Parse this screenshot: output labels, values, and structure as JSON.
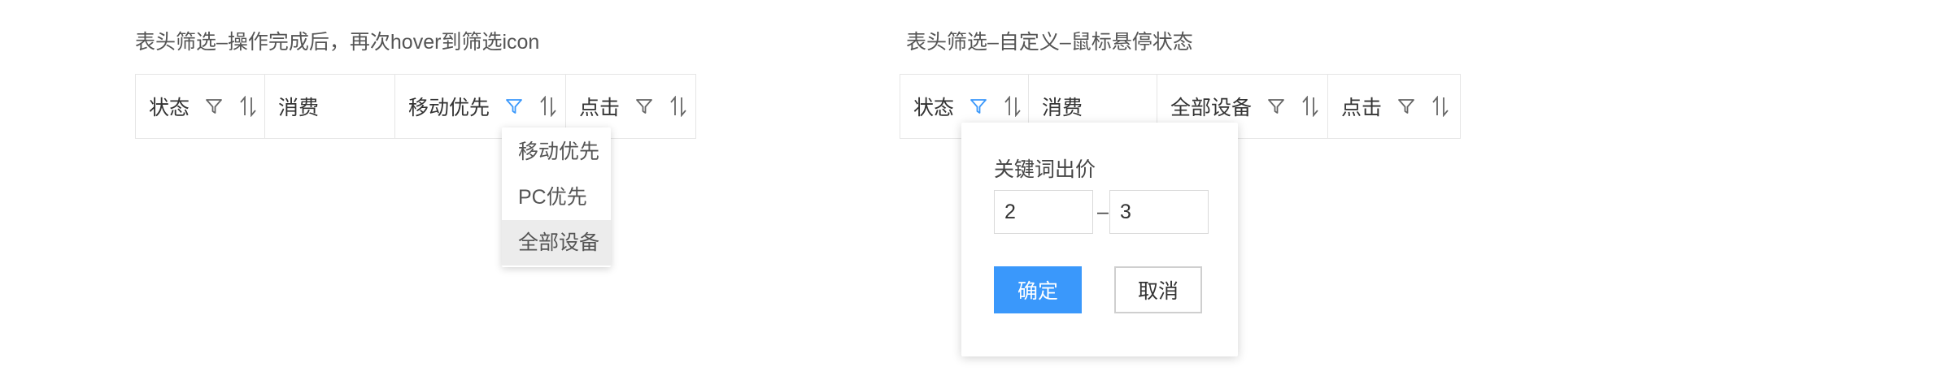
{
  "left": {
    "caption": "表头筛选–操作完成后，再次hover到筛选icon",
    "columns": [
      {
        "label": "状态",
        "filter_icon": "filter-icon",
        "sort_icon": "sort-icon"
      },
      {
        "label": "消费"
      },
      {
        "label": "移动优先",
        "filter_icon": "filter-icon",
        "filter_active": true,
        "sort_icon": "sort-icon"
      },
      {
        "label": "点击",
        "filter_icon": "filter-icon",
        "sort_icon": "sort-icon"
      }
    ],
    "dropdown": {
      "options": [
        "移动优先",
        "PC优先",
        "全部设备"
      ],
      "hovered_index": 2
    }
  },
  "right": {
    "caption": "表头筛选–自定义–鼠标悬停状态",
    "columns": [
      {
        "label": "状态",
        "filter_icon": "filter-icon",
        "filter_active": true,
        "sort_icon": "sort-icon"
      },
      {
        "label": "消费"
      },
      {
        "label": "全部设备",
        "filter_icon": "filter-icon",
        "sort_icon": "sort-icon"
      },
      {
        "label": "点击",
        "filter_icon": "filter-icon",
        "sort_icon": "sort-icon"
      }
    ],
    "popover": {
      "title": "关键词出价",
      "min_value": "2",
      "separator": "–",
      "max_value": "3",
      "confirm_label": "确定",
      "cancel_label": "取消"
    }
  },
  "colors": {
    "accent": "#3a98fb",
    "icon": "#666666",
    "border": "#e6e6e6",
    "hover_bg": "#ececec"
  }
}
